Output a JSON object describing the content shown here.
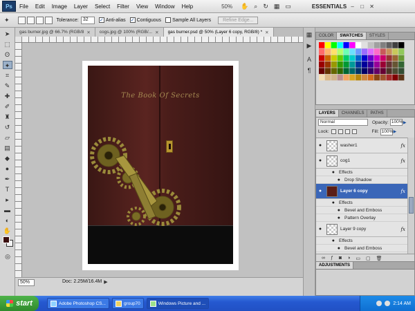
{
  "menubar": {
    "logo": "Ps",
    "items": [
      "File",
      "Edit",
      "Image",
      "Layer",
      "Select",
      "Filter",
      "View",
      "Window",
      "Help"
    ],
    "zoom": "50%",
    "workspace": "ESSENTIALS",
    "min": "–",
    "max": "□",
    "close": "✕"
  },
  "options": {
    "tolerance_label": "Tolerance:",
    "tolerance_value": "32",
    "anti_alias": "Anti-alias",
    "contiguous": "Contiguous",
    "sample_all": "Sample All Layers",
    "refine_edge": "Refine Edge..."
  },
  "doc_tabs": [
    {
      "label": "gas burner.jpg @ 66.7% (RGB/8"
    },
    {
      "label": "cogs.jpg @ 100% (RGB/..."
    },
    {
      "label": "gas burner.psd @ 50% (Layer 6 copy, RGB/8) *"
    }
  ],
  "canvas": {
    "book_title": "The Book  Of Secrets"
  },
  "status": {
    "zoom": "50%",
    "doc_size": "Doc: 2.25M/16.4M"
  },
  "swatches_panel": {
    "tabs": [
      "COLOR",
      "SWATCHES",
      "STYLES"
    ],
    "colors": [
      "#ff0000",
      "#ffff00",
      "#00ff00",
      "#00ffff",
      "#0000ff",
      "#ff00ff",
      "#ffffff",
      "#e0e0e0",
      "#c0c0c0",
      "#a0a0a0",
      "#808080",
      "#606060",
      "#404040",
      "#000000",
      "#ff6b6b",
      "#ffb36b",
      "#ffe06b",
      "#b3ff6b",
      "#6bffb3",
      "#6be0ff",
      "#6b9bff",
      "#9b6bff",
      "#e06bff",
      "#ff6bc8",
      "#c85a5a",
      "#c8905a",
      "#c8c85a",
      "#90c85a",
      "#cc0000",
      "#cc6600",
      "#cccc00",
      "#66cc00",
      "#00cc66",
      "#00cccc",
      "#0066cc",
      "#0000cc",
      "#6600cc",
      "#cc00cc",
      "#cc0066",
      "#993333",
      "#996633",
      "#669933",
      "#990000",
      "#993300",
      "#999900",
      "#339900",
      "#009933",
      "#009999",
      "#003399",
      "#000099",
      "#330099",
      "#990099",
      "#990033",
      "#663333",
      "#665533",
      "#336633",
      "#660000",
      "#663300",
      "#666600",
      "#336600",
      "#006633",
      "#006666",
      "#003366",
      "#000066",
      "#330066",
      "#660066",
      "#660033",
      "#4d3326",
      "#4d4d33",
      "#334d33",
      "#f5deb3",
      "#deb887",
      "#d2b48c",
      "#bc8f8f",
      "#f4a460",
      "#daa520",
      "#b8860b",
      "#cd853f",
      "#d2691e",
      "#8b4513",
      "#a0522d",
      "#a52a2a",
      "#800000",
      "#5c3317"
    ]
  },
  "layers_panel": {
    "tabs": [
      "LAYERS",
      "CHANNELS",
      "PATHS"
    ],
    "blend_mode": "Normal",
    "opacity_label": "Opacity:",
    "opacity_value": "100%",
    "lock_label": "Lock:",
    "fill_label": "Fill:",
    "fill_value": "100%",
    "rows": {
      "washer1": "washer1",
      "cog1": "cog1",
      "cog1_effects": "Effects",
      "cog1_drop_shadow": "Drop Shadow",
      "layer6copy": "Layer 6 copy",
      "layer6copy_effects": "Effects",
      "layer6copy_bevel": "Bevel and Emboss",
      "layer6copy_pattern": "Pattern Overlay",
      "layer9copy": "Layer 9 copy",
      "layer9copy_effects": "Effects",
      "layer9copy_bevel": "Bevel and Emboss"
    },
    "fx": "fx",
    "footer_icons": [
      "link-icon",
      "fx-icon",
      "mask-icon",
      "adjustment-icon",
      "group-icon",
      "new-layer-icon",
      "trash-icon"
    ]
  },
  "adjustments_panel": {
    "title": "ADJUSTMENTS"
  },
  "taskbar": {
    "start": "start",
    "buttons": [
      {
        "label": "Adobe Photoshop CS..."
      },
      {
        "label": "group70"
      },
      {
        "label": "Windows Picture and ..."
      }
    ],
    "clock": "2:14 AM"
  }
}
